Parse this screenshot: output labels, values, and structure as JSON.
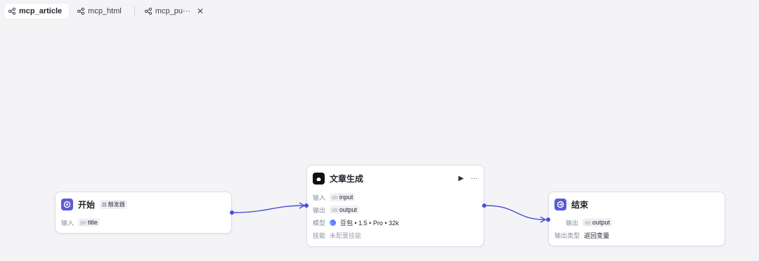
{
  "tabs": [
    {
      "label": "mcp_article",
      "active": true
    },
    {
      "label": "mcp_html",
      "active": false
    },
    {
      "label": "mcp_pu···",
      "active": false,
      "closable": true
    }
  ],
  "tab_close_glyph": "✕",
  "colors": {
    "accent": "#4b4fd8",
    "node_icon": "#5b5bd6",
    "canvas_bg": "#f4f4f7"
  },
  "nodes": {
    "start": {
      "title": "开始",
      "badge": "触发器",
      "input_label": "输入",
      "input_type": "str",
      "input_name": "title",
      "icon": "start-icon"
    },
    "article": {
      "title": "文章生成",
      "icon": "llm-icon",
      "input_label": "输入",
      "input_type": "str",
      "input_name": "input",
      "output_label": "输出",
      "output_type": "str",
      "output_name": "output",
      "model_label": "模型",
      "model_value": "豆包 • 1.5 • Pro • 32k",
      "skill_label": "技能",
      "skill_value": "未配置技能",
      "run_glyph": "▶",
      "more_glyph": "···"
    },
    "end": {
      "title": "结束",
      "icon": "end-icon",
      "output_label": "输出",
      "output_type": "str",
      "output_name": "output",
      "type_label": "输出类型",
      "type_value": "返回变量"
    }
  }
}
